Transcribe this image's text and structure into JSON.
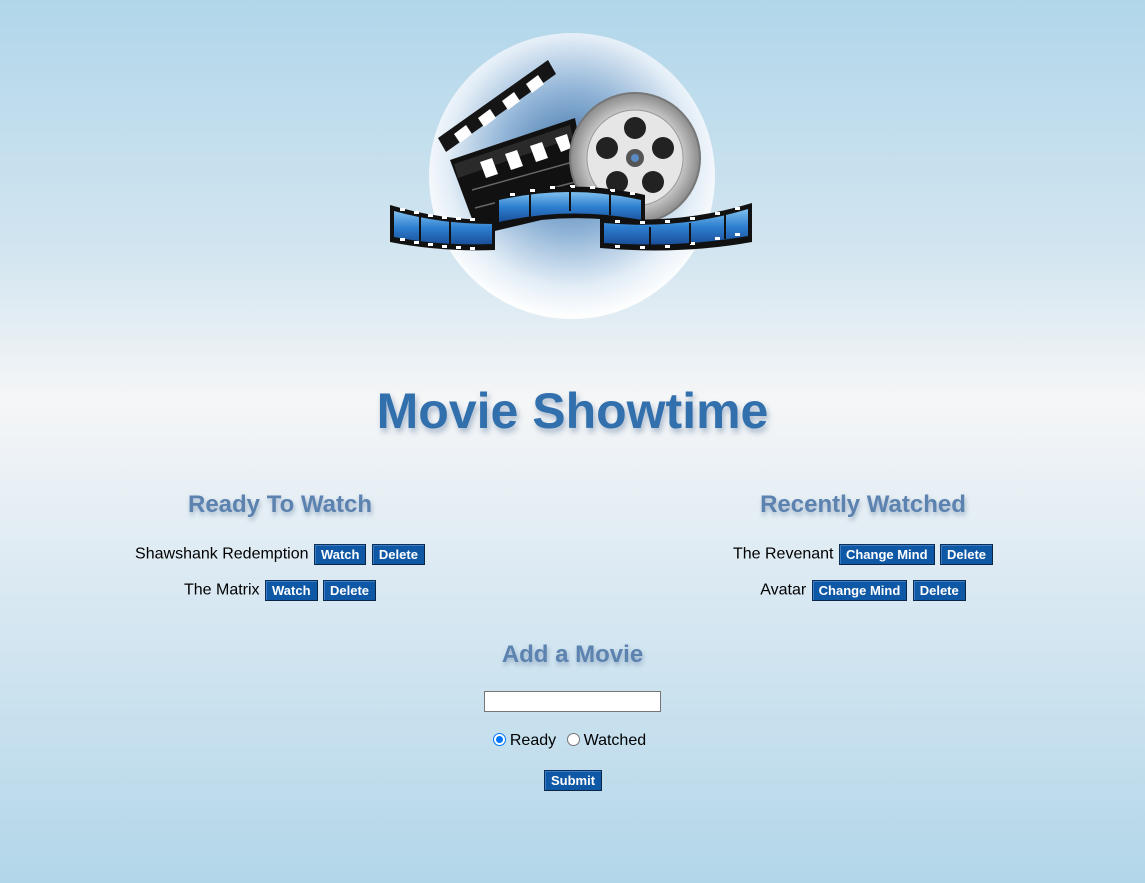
{
  "header": {
    "title": "Movie Showtime",
    "logo_icon": "movie-clapperboard-film-reel-logo"
  },
  "ready_to_watch": {
    "heading": "Ready To Watch",
    "movies": [
      {
        "title": "Shawshank Redemption",
        "primary_action": "Watch",
        "delete_action": "Delete"
      },
      {
        "title": "The Matrix",
        "primary_action": "Watch",
        "delete_action": "Delete"
      }
    ]
  },
  "recently_watched": {
    "heading": "Recently Watched",
    "movies": [
      {
        "title": "The Revenant",
        "primary_action": "Change Mind",
        "delete_action": "Delete"
      },
      {
        "title": "Avatar",
        "primary_action": "Change Mind",
        "delete_action": "Delete"
      }
    ]
  },
  "add_movie": {
    "heading": "Add a Movie",
    "input_value": "",
    "input_placeholder": "",
    "options": [
      {
        "label": "Ready",
        "checked": true
      },
      {
        "label": "Watched",
        "checked": false
      }
    ],
    "submit_label": "Submit"
  },
  "colors": {
    "title": "#3170ad",
    "heading": "#5c82b0",
    "button": "#0f58a6",
    "radio_accent": "#0075ff"
  }
}
